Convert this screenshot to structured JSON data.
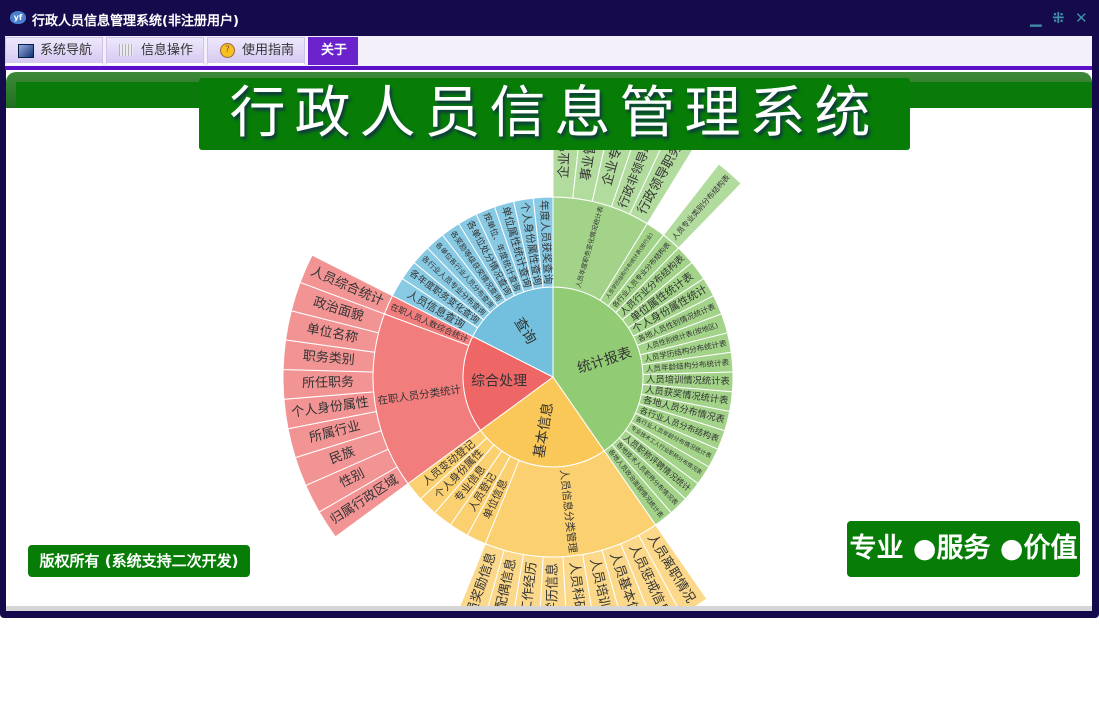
{
  "window": {
    "title": "行政人员信息管理系统(非注册用户)",
    "controls": [
      "minimize",
      "restore",
      "close"
    ]
  },
  "menu": {
    "tabs": [
      {
        "label": "系统导航",
        "icon": "monitor-icon"
      },
      {
        "label": "信息操作",
        "icon": "grid-icon"
      },
      {
        "label": "使用指南",
        "icon": "help-icon"
      },
      {
        "label": "关于",
        "icon": ""
      }
    ],
    "active": 3
  },
  "banner": {
    "title": "行政人员信息管理系统"
  },
  "footer": {
    "copyright": "版权所有 (系统支持二次开发)",
    "slogan": "专业 ●服务 ●价值"
  },
  "sunburst": [
    {
      "name": "统计报表",
      "color": "#91cb74",
      "children": [
        {
          "name": "人员年度职务变化情况统计表",
          "children": [
            {
              "name": "企业管理"
            },
            {
              "name": "事业管理"
            },
            {
              "name": "企业专业"
            },
            {
              "name": "行政非领导职务"
            },
            {
              "name": "行政领导职务"
            }
          ]
        },
        {
          "name": "人员学历结构分布统计表(按行业)"
        },
        {
          "name": "各行业人员专业分布结构表",
          "children": [
            {
              "name": "人员专业类别分布结构表"
            }
          ]
        },
        {
          "name": "人员行业分布结构表"
        },
        {
          "name": "单位属性统计表"
        },
        {
          "name": "个人身份属性统计"
        },
        {
          "name": "各地人员性别情况统计表"
        },
        {
          "name": "人员性别统计表(按地区)"
        },
        {
          "name": "人员学历结构分布统计表"
        },
        {
          "name": "人员年龄结构分布统计表"
        },
        {
          "name": "人员培训情况统计表"
        },
        {
          "name": "人员获奖情况统计表"
        },
        {
          "name": "各地人员分布情况表"
        },
        {
          "name": "各行业人员分布结构表"
        },
        {
          "name": "各行业人员年龄分布情况统计表"
        },
        {
          "name": "专业技术工人行业职称分布情况表"
        },
        {
          "name": "人员职称评聘情况统计"
        },
        {
          "name": "各地技术人员职称分布情况表"
        },
        {
          "name": "各地人员政治面貌情况统计表"
        }
      ]
    },
    {
      "name": "基本信息",
      "color": "#fac858",
      "children": [
        {
          "name": "人员信息分类管理",
          "children": [
            {
              "name": "人员离职情况"
            },
            {
              "name": "人员惩戒信息"
            },
            {
              "name": "人员基本信息"
            },
            {
              "name": "人员培训信息"
            },
            {
              "name": "人员科研信息"
            },
            {
              "name": "人员学历信息"
            },
            {
              "name": "人员工作经历"
            },
            {
              "name": "人员配偶信息"
            },
            {
              "name": "人员奖励信息"
            }
          ]
        },
        {
          "name": "单位信息"
        },
        {
          "name": "人员登记"
        },
        {
          "name": "专业信息"
        },
        {
          "name": "个人身份属性"
        },
        {
          "name": "人员变动登记"
        }
      ]
    },
    {
      "name": "综合处理",
      "color": "#ee6666",
      "children": [
        {
          "name": "在职人员分类统计",
          "children": [
            {
              "name": "归属行政区域"
            },
            {
              "name": "性别"
            },
            {
              "name": "民族"
            },
            {
              "name": "所属行业"
            },
            {
              "name": "个人身份属性"
            },
            {
              "name": "所任职务"
            },
            {
              "name": "职务类别"
            },
            {
              "name": "单位名称"
            },
            {
              "name": "政治面貌"
            }
          ]
        },
        {
          "name": "在职人员人数综合统计",
          "children": [
            {
              "name": "人员综合统计"
            }
          ]
        }
      ]
    },
    {
      "name": "查询",
      "color": "#73c0de",
      "children": [
        {
          "name": "人员信息查询"
        },
        {
          "name": "各年度职务变化查询"
        },
        {
          "name": "各行业人员专业分布查询"
        },
        {
          "name": "各单位各行业人员分布查询"
        },
        {
          "name": "各奖励等级获奖情况查询"
        },
        {
          "name": "各单位处分情况查询"
        },
        {
          "name": "按单位、年度统计查询"
        },
        {
          "name": "单位属性统计查询"
        },
        {
          "name": "个人身份属性查询"
        },
        {
          "name": "年度人员获奖查询"
        }
      ]
    }
  ]
}
